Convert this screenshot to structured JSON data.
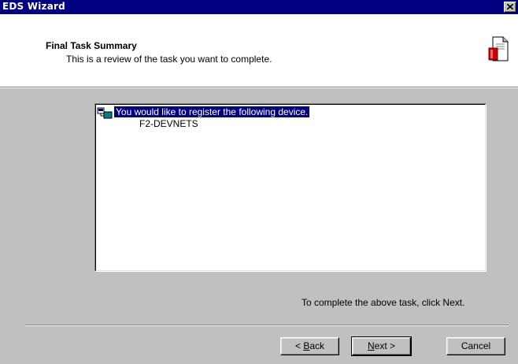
{
  "window": {
    "title": "EDS Wizard",
    "close_glyph": "✕"
  },
  "header": {
    "title": "Final Task Summary",
    "subtitle": "This is a review of the task you want to complete.",
    "icon": "document-icon"
  },
  "summary": {
    "root_label": "You would like to register the following device.",
    "root_icon": "network-device-icon",
    "device_name": "F2-DEVNETS"
  },
  "instruction": "To complete the above task, click Next.",
  "buttons": {
    "back": {
      "prefix": "< ",
      "accel": "B",
      "rest": "ack"
    },
    "next": {
      "accel": "N",
      "rest": "ext >"
    },
    "cancel": "Cancel"
  },
  "colors": {
    "titlebar": "#000080",
    "dialog_bg": "#c0c0c0",
    "selection": "#000080",
    "document_red": "#cc0000"
  }
}
